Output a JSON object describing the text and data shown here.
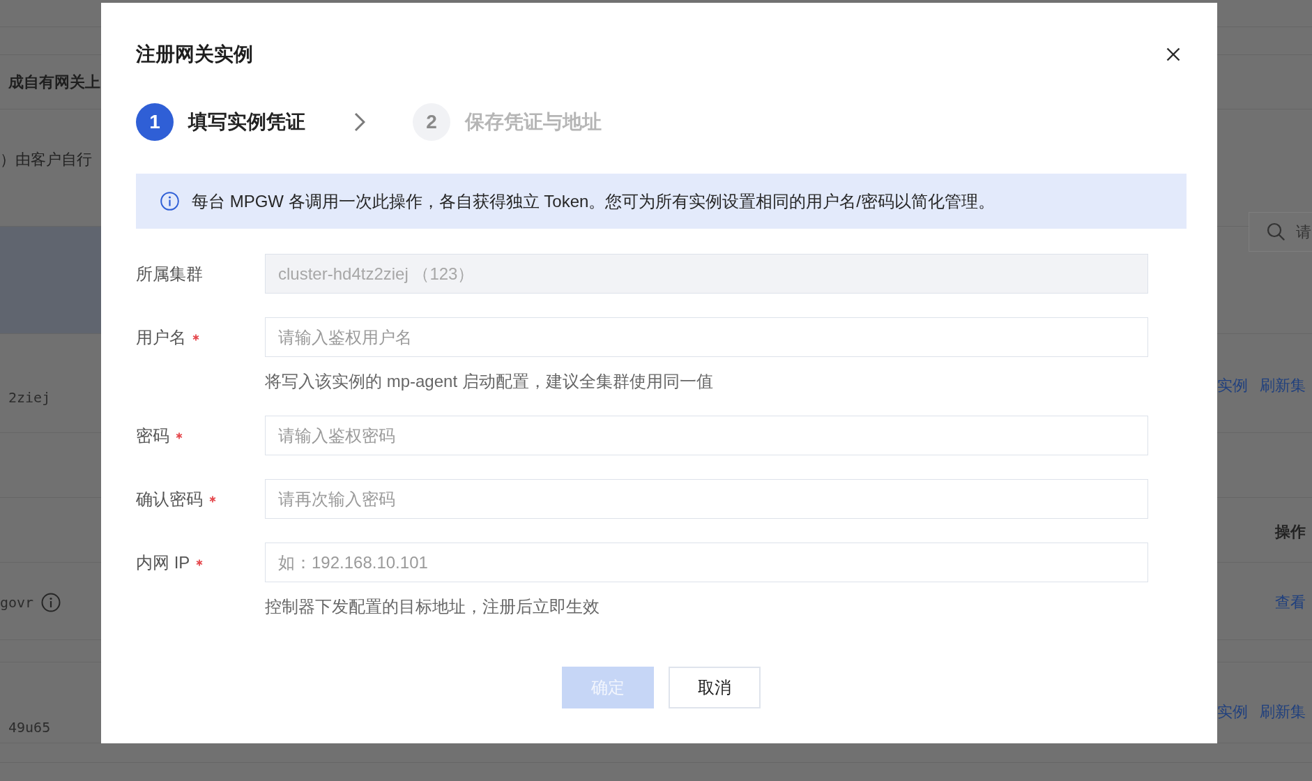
{
  "background": {
    "heading": "成自有网关上",
    "description": "）由客户自行",
    "search": {
      "placeholder": "请"
    },
    "column_header": "操作",
    "rows": [
      {
        "cell": "2ziej",
        "info": false,
        "actions": [
          "实例",
          "刷新集"
        ]
      },
      {
        "cell": "govr",
        "info": true,
        "actions": [
          "查看"
        ]
      },
      {
        "cell": "49u65",
        "info": false,
        "actions": [
          "实例",
          "刷新集"
        ]
      }
    ]
  },
  "dialog": {
    "title": "注册网关实例",
    "steps": [
      {
        "number": "1",
        "label": "填写实例凭证",
        "selected": true
      },
      {
        "number": "2",
        "label": "保存凭证与地址",
        "selected": false
      }
    ],
    "notice": "每台 MPGW 各调用一次此操作，各自获得独立 Token。您可为所有实例设置相同的用户名/密码以简化管理。",
    "fields": [
      {
        "label": "所属集群",
        "required": false,
        "disabled": true,
        "value": "cluster-hd4tz2ziej （123）"
      },
      {
        "label": "用户名",
        "required": true,
        "disabled": false,
        "placeholder": "请输入鉴权用户名",
        "hint": "将写入该实例的 mp-agent 启动配置，建议全集群使用同一值"
      },
      {
        "label": "密码",
        "required": true,
        "disabled": false,
        "placeholder": "请输入鉴权密码"
      },
      {
        "label": "确认密码",
        "required": true,
        "disabled": false,
        "placeholder": "请再次输入密码"
      },
      {
        "label": "内网 IP",
        "required": true,
        "disabled": false,
        "placeholder": "如：192.168.10.101",
        "hint": "控制器下发配置的目标地址，注册后立即生效"
      }
    ],
    "buttons": [
      {
        "label": "确定",
        "kind": "primary",
        "disabled": true
      },
      {
        "label": "取消",
        "kind": "default",
        "disabled": false
      }
    ]
  }
}
